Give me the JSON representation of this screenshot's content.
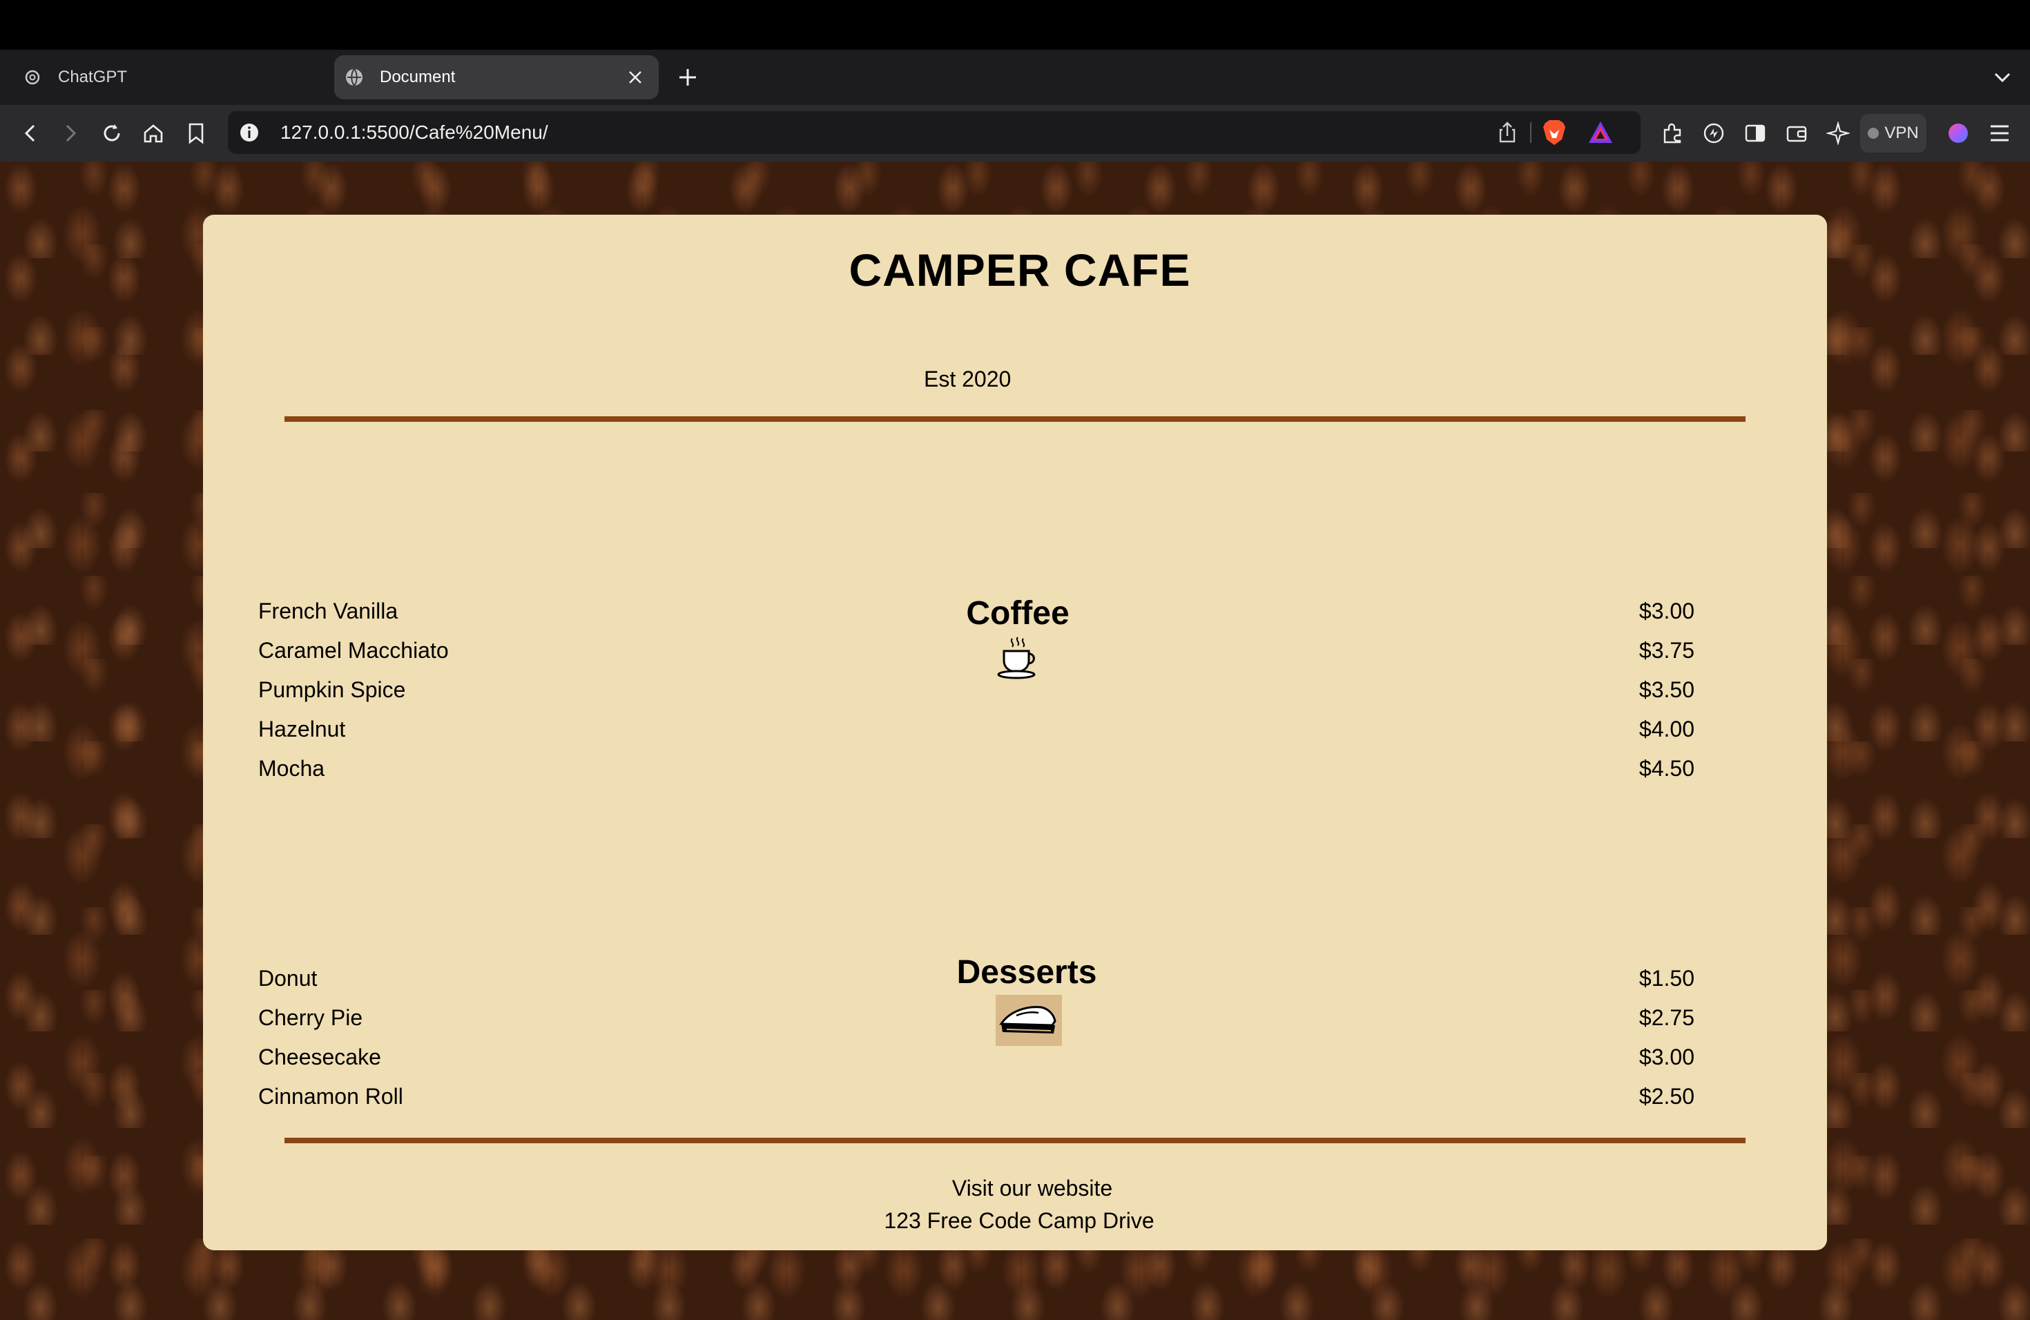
{
  "browser": {
    "tabs": [
      {
        "label": "ChatGPT",
        "active": false
      },
      {
        "label": "Document",
        "active": true
      }
    ],
    "url": "127.0.0.1:5500/Cafe%20Menu/",
    "vpn_label": "VPN"
  },
  "menu": {
    "title": "CAMPER CAFE",
    "established": "Est 2020",
    "sections": [
      {
        "title": "Coffee",
        "icon": "coffee-cup-icon",
        "items": [
          {
            "name": "French Vanilla",
            "price": "$3.00"
          },
          {
            "name": "Caramel Macchiato",
            "price": "$3.75"
          },
          {
            "name": "Pumpkin Spice",
            "price": "$3.50"
          },
          {
            "name": "Hazelnut",
            "price": "$4.00"
          },
          {
            "name": "Mocha",
            "price": "$4.50"
          }
        ]
      },
      {
        "title": "Desserts",
        "icon": "pie-slice-icon",
        "items": [
          {
            "name": "Donut",
            "price": "$1.50"
          },
          {
            "name": "Cherry Pie",
            "price": "$2.75"
          },
          {
            "name": "Cheesecake",
            "price": "$3.00"
          },
          {
            "name": "Cinnamon Roll",
            "price": "$2.50"
          }
        ]
      }
    ],
    "footer": {
      "link_text": "Visit our website",
      "address": "123 Free Code Camp Drive"
    }
  },
  "colors": {
    "menu_background": "#f0deb4",
    "divider": "#8b4513",
    "page_background": "#3b1d0e"
  }
}
